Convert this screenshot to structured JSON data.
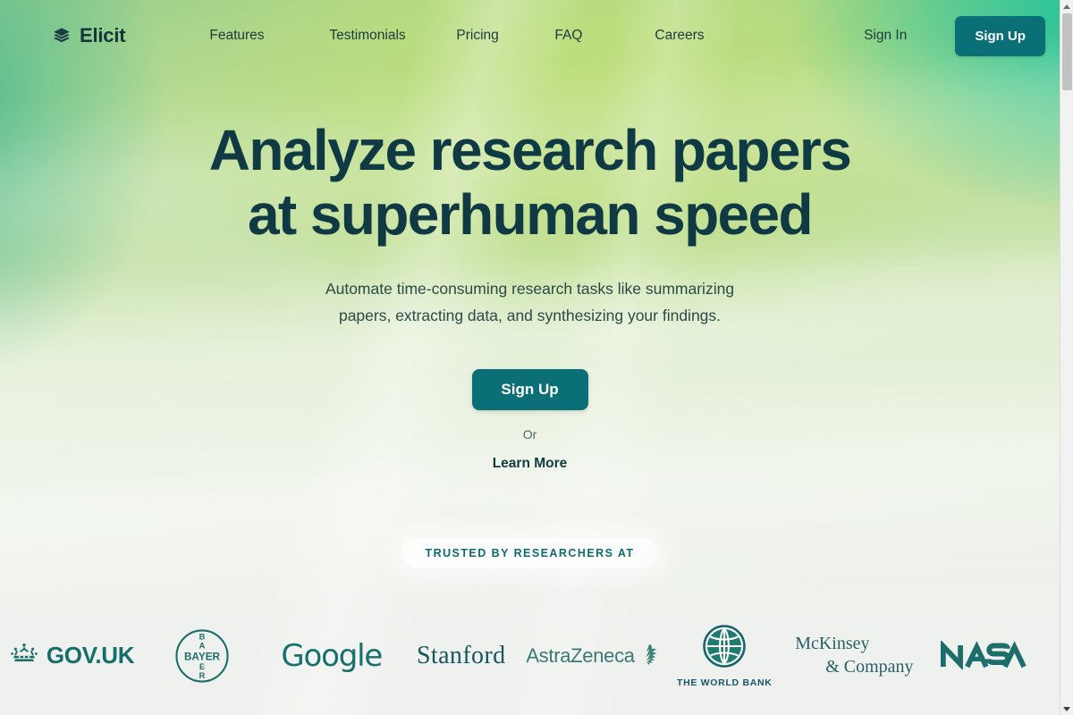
{
  "brand": {
    "name": "Elicit",
    "logo_icon": "stacked-books-icon",
    "logo_color": "#17343a"
  },
  "theme": {
    "accent": "#0b6f78",
    "headline_color": "#0f3a44",
    "pill_text_color": "#0e6b72",
    "logo_strip_color": "#1b6e6b"
  },
  "nav": {
    "links": [
      {
        "label": "Features"
      },
      {
        "label": "Testimonials"
      },
      {
        "label": "Pricing"
      },
      {
        "label": "FAQ"
      },
      {
        "label": "Careers"
      }
    ],
    "sign_in_label": "Sign In",
    "sign_up_label": "Sign Up"
  },
  "hero": {
    "headline_line1": "Analyze research papers",
    "headline_line2": "at superhuman speed",
    "subhead_line1": "Automate time-consuming research tasks like summarizing",
    "subhead_line2": "papers, extracting data, and synthesizing your findings.",
    "cta_primary_label": "Sign Up",
    "or_label": "Or",
    "cta_secondary_label": "Learn More"
  },
  "trusted": {
    "pill_label": "TRUSTED BY RESEARCHERS AT",
    "logos": [
      {
        "name": "GOV.UK",
        "text": "GOV.UK",
        "icon": "crown-icon"
      },
      {
        "name": "Bayer",
        "text": "BAYER",
        "icon": "bayer-cross-icon"
      },
      {
        "name": "Google",
        "text": "Google",
        "icon": "none"
      },
      {
        "name": "Stanford",
        "text": "Stanford",
        "icon": "none"
      },
      {
        "name": "AstraZeneca",
        "text": "AstraZeneca",
        "icon": "astrazeneca-swirl-icon"
      },
      {
        "name": "The World Bank",
        "text": "THE WORLD BANK",
        "icon": "globe-icon"
      },
      {
        "name": "McKinsey & Company",
        "text_line1": "McKinsey",
        "text_line2": "& Company",
        "icon": "none"
      },
      {
        "name": "NASA",
        "text": "NASA",
        "icon": "nasa-worm-icon"
      }
    ]
  }
}
